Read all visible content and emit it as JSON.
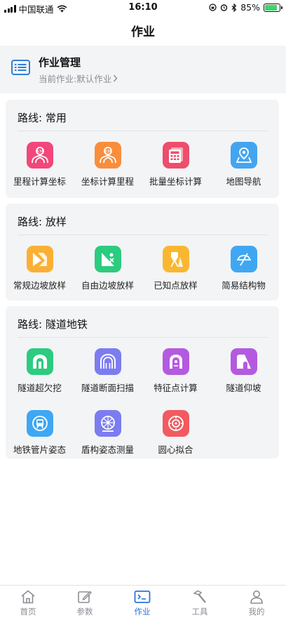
{
  "status_bar": {
    "carrier": "中国联通",
    "time": "16:10",
    "battery": "85%",
    "battery_level": 0.85
  },
  "header": {
    "title": "作业"
  },
  "management": {
    "title": "作业管理",
    "subtitle": "当前作业:默认作业",
    "icon": "list-icon"
  },
  "sections": [
    {
      "title": "路线:  常用",
      "items": [
        {
          "label": "里程计算坐标",
          "icon": "route-icon",
          "color": "#f2477a"
        },
        {
          "label": "坐标计算里程",
          "icon": "route-icon",
          "color": "#f98d3c"
        },
        {
          "label": "批量坐标计算",
          "icon": "calculator-icon",
          "color": "#ee4d6b"
        },
        {
          "label": "地图导航",
          "icon": "map-pin-icon",
          "color": "#43a5f0"
        }
      ]
    },
    {
      "title": "路线:  放样",
      "items": [
        {
          "label": "常规边坡放样",
          "icon": "slope-icon",
          "color": "#fbb034"
        },
        {
          "label": "自由边坡放样",
          "icon": "free-slope-icon",
          "color": "#2ccb7f"
        },
        {
          "label": "已知点放样",
          "icon": "total-station-icon",
          "color": "#f9b731"
        },
        {
          "label": "简易结构物",
          "icon": "structure-icon",
          "color": "#3fa7f2"
        }
      ]
    },
    {
      "title": "路线:  隧道地铁",
      "items": [
        {
          "label": "隧道超欠挖",
          "icon": "tunnel-icon",
          "color": "#2ccb7f"
        },
        {
          "label": "隧道断面扫描",
          "icon": "tunnel-scan-icon",
          "color": "#7c7cf1"
        },
        {
          "label": "特征点计算",
          "icon": "feature-point-icon",
          "color": "#b45ae0"
        },
        {
          "label": "隧道仰坡",
          "icon": "tunnel-slope-icon",
          "color": "#b45ae0"
        },
        {
          "label": "地铁管片姿态",
          "icon": "metro-icon",
          "color": "#3fa7f2"
        },
        {
          "label": "盾构姿态测量",
          "icon": "shield-machine-icon",
          "color": "#7c7cf1"
        },
        {
          "label": "圆心拟合",
          "icon": "circle-fit-icon",
          "color": "#f25a60"
        }
      ]
    }
  ],
  "tabbar": {
    "items": [
      {
        "label": "首页",
        "icon": "home-icon",
        "active": false
      },
      {
        "label": "参数",
        "icon": "edit-icon",
        "active": false
      },
      {
        "label": "作业",
        "icon": "terminal-icon",
        "active": true
      },
      {
        "label": "工具",
        "icon": "hammer-icon",
        "active": false
      },
      {
        "label": "我的",
        "icon": "user-icon",
        "active": false
      }
    ]
  }
}
